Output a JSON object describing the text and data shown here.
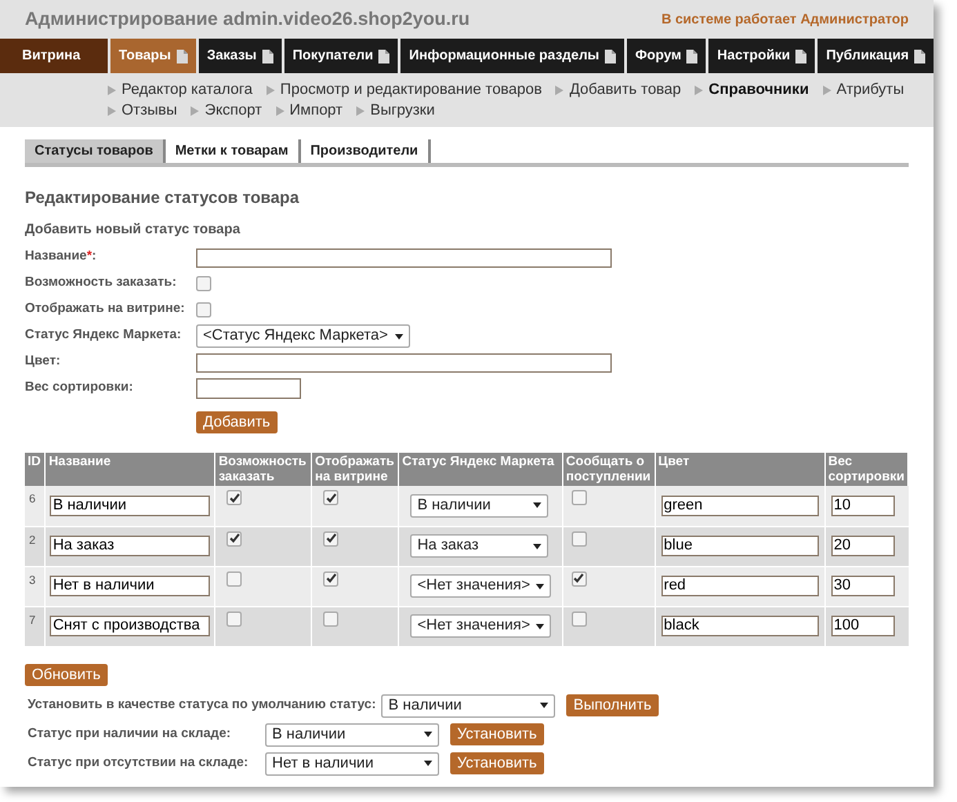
{
  "header": {
    "title": "Администрирование admin.video26.shop2you.ru",
    "user_note": "В системе работает Администратор"
  },
  "nav": [
    {
      "label": "Витрина",
      "kind": "storefront",
      "selected": false
    },
    {
      "label": "Товары",
      "kind": "menu",
      "selected": true
    },
    {
      "label": "Заказы",
      "kind": "menu",
      "selected": false
    },
    {
      "label": "Покупатели",
      "kind": "menu",
      "selected": false
    },
    {
      "label": "Информационные разделы",
      "kind": "menu",
      "selected": false
    },
    {
      "label": "Форум",
      "kind": "menu",
      "selected": false
    },
    {
      "label": "Настройки",
      "kind": "menu",
      "selected": false
    },
    {
      "label": "Публикация",
      "kind": "menu",
      "selected": false
    }
  ],
  "subnav": [
    [
      {
        "label": "Редактор каталога",
        "selected": false
      },
      {
        "label": "Просмотр и редактирование товаров",
        "selected": false
      },
      {
        "label": "Добавить товар",
        "selected": false
      },
      {
        "label": "Справочники",
        "selected": true
      },
      {
        "label": "Атрибуты",
        "selected": false
      }
    ],
    [
      {
        "label": "Отзывы",
        "selected": false
      },
      {
        "label": "Экспорт",
        "selected": false
      },
      {
        "label": "Импорт",
        "selected": false
      },
      {
        "label": "Выгрузки",
        "selected": false
      }
    ]
  ],
  "tabs": [
    {
      "label": "Статусы товаров",
      "selected": true
    },
    {
      "label": "Метки к товарам",
      "selected": false
    },
    {
      "label": "Производители",
      "selected": false
    }
  ],
  "page_title": "Редактирование статусов товара",
  "add_form": {
    "title": "Добавить новый статус товара",
    "fields": [
      {
        "label": "Название",
        "required_mark": "*",
        "label_end": ":",
        "kind": "text"
      },
      {
        "label": "Возможность заказать:",
        "kind": "checkbox",
        "checked": false
      },
      {
        "label": "Отображать на витрине:",
        "kind": "checkbox",
        "checked": false
      },
      {
        "label": "Статус Яндекс Маркета:",
        "kind": "select",
        "value": "<Статус Яндекс Маркета>"
      },
      {
        "label": "Цвет:",
        "kind": "text"
      },
      {
        "label": "Вес сортировки:",
        "kind": "short"
      }
    ],
    "button": "Добавить"
  },
  "table": {
    "columns": [
      "ID",
      "Название",
      "Возможность заказать",
      "Отображать на витрине",
      "Статус Яндекс Маркета",
      "Сообщать о поступлении",
      "Цвет",
      "Вес сортировки"
    ],
    "rows": [
      {
        "id": "6",
        "name": "В наличии",
        "orderable": true,
        "visible": true,
        "market": "В наличии",
        "notify": false,
        "color_value": "green",
        "weight": "10"
      },
      {
        "id": "2",
        "name": "На заказ",
        "orderable": true,
        "visible": true,
        "market": "На заказ",
        "notify": false,
        "color_value": "blue",
        "weight": "20"
      },
      {
        "id": "3",
        "name": "Нет в наличии",
        "orderable": false,
        "visible": true,
        "market": "<Нет значения>",
        "notify": true,
        "color_value": "red",
        "weight": "30"
      },
      {
        "id": "7",
        "name": "Снят с производства",
        "orderable": false,
        "visible": false,
        "market": "<Нет значения>",
        "notify": false,
        "color_value": "black",
        "weight": "100"
      }
    ]
  },
  "update_button": "Обновить",
  "settings": [
    {
      "label": "Установить в качестве статуса по умолчанию статус:",
      "value": "В наличии",
      "button": "Выполнить"
    },
    {
      "label": "Статус при наличии на складе:",
      "value": "В наличии",
      "button": "Установить"
    },
    {
      "label": "Статус при отсутствии на складе:",
      "value": "Нет в наличии",
      "button": "Установить"
    }
  ]
}
